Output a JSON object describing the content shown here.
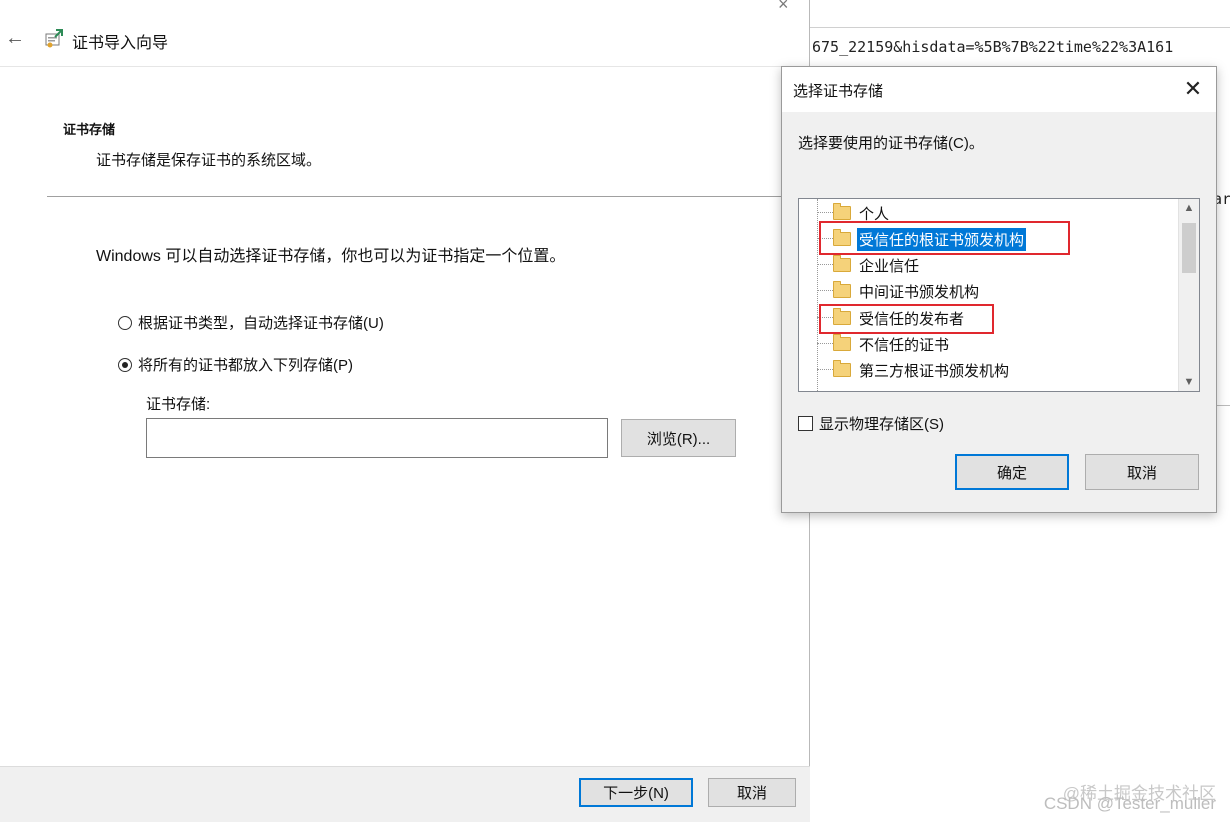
{
  "background": {
    "url_fragment": "675_22159&hisdata=%5B%7B%22time%22%3A161",
    "side_text": "ar"
  },
  "wizard": {
    "title": "证书导入向导",
    "section_heading": "证书存储",
    "section_desc": "证书存储是保存证书的系统区域。",
    "intro_text": "Windows 可以自动选择证书存储，你也可以为证书指定一个位置。",
    "radio_auto_label": "根据证书类型，自动选择证书存储(U)",
    "radio_manual_label": "将所有的证书都放入下列存储(P)",
    "radio_selected": "manual",
    "store_label": "证书存储:",
    "store_value": "",
    "browse_label": "浏览(R)...",
    "next_label": "下一步(N)",
    "cancel_label": "取消"
  },
  "dialog": {
    "title": "选择证书存储",
    "prompt": "选择要使用的证书存储(C)。",
    "stores": [
      {
        "label": "个人",
        "selected": false,
        "highlighted": false
      },
      {
        "label": "受信任的根证书颁发机构",
        "selected": true,
        "highlighted": true
      },
      {
        "label": "企业信任",
        "selected": false,
        "highlighted": false
      },
      {
        "label": "中间证书颁发机构",
        "selected": false,
        "highlighted": false
      },
      {
        "label": "受信任的发布者",
        "selected": false,
        "highlighted": true
      },
      {
        "label": "不信任的证书",
        "selected": false,
        "highlighted": false
      },
      {
        "label": "第三方根证书颁发机构",
        "selected": false,
        "highlighted": false
      }
    ],
    "show_physical_label": "显示物理存储区(S)",
    "show_physical_checked": false,
    "ok_label": "确定",
    "cancel_label": "取消"
  },
  "watermark": {
    "line1": "@稀土掘金技术社区",
    "line2": "CSDN @Tester_muller"
  },
  "colors": {
    "accent": "#0078d7",
    "highlight_red": "#e0282e",
    "folder": "#f5d27a"
  }
}
